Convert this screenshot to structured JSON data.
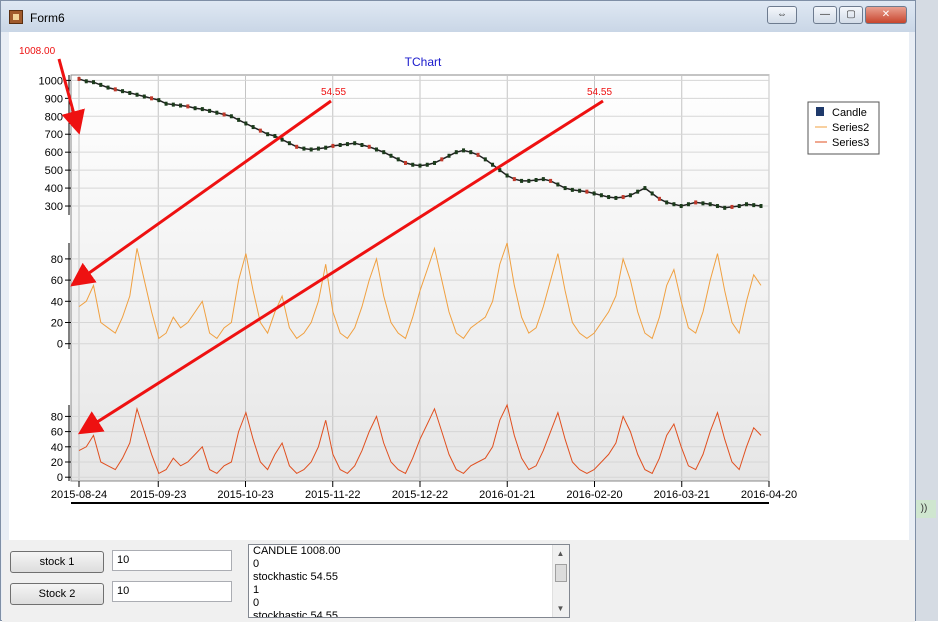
{
  "window": {
    "title": "Form6"
  },
  "titlebar_buttons": [
    "⇔",
    "—",
    "▢",
    "✕"
  ],
  "annotations": {
    "candle_value": "1008.00",
    "stoch_value_1": "54.55",
    "stoch_value_2": "54.55"
  },
  "chart_data": {
    "type": "line",
    "title": "TChart",
    "legend": {
      "placement": "top-right",
      "entries": [
        {
          "name": "Candle",
          "color": "#1f3a6b"
        },
        {
          "name": "Series2",
          "color": "#f0a040"
        },
        {
          "name": "Series3",
          "color": "#e05020"
        }
      ]
    },
    "x_tick_labels": [
      "2015-08-24",
      "2015-09-23",
      "2015-10-23",
      "2015-11-22",
      "2015-12-22",
      "2016-01-21",
      "2016-02-20",
      "2016-03-21",
      "2016-04-20"
    ],
    "panes": [
      {
        "series": "Candle",
        "y_ticks": [
          1000,
          900,
          800,
          700,
          600,
          500,
          400,
          300
        ],
        "ylim": [
          250,
          1030
        ],
        "values": [
          1008,
          995,
          990,
          975,
          960,
          950,
          940,
          930,
          920,
          910,
          900,
          890,
          870,
          865,
          860,
          855,
          845,
          840,
          830,
          820,
          810,
          800,
          780,
          760,
          740,
          720,
          700,
          690,
          670,
          650,
          630,
          620,
          615,
          620,
          625,
          635,
          640,
          645,
          650,
          640,
          630,
          615,
          600,
          580,
          560,
          540,
          530,
          525,
          530,
          540,
          560,
          580,
          600,
          610,
          600,
          585,
          560,
          530,
          500,
          470,
          450,
          440,
          440,
          445,
          450,
          440,
          420,
          400,
          390,
          385,
          380,
          370,
          360,
          350,
          345,
          350,
          360,
          380,
          400,
          370,
          340,
          320,
          310,
          300,
          310,
          320,
          315,
          310,
          300,
          290,
          295,
          300,
          310,
          305,
          300
        ]
      },
      {
        "series": "Series2",
        "y_ticks": [
          80,
          60,
          40,
          20,
          0
        ],
        "ylim": [
          -5,
          95
        ],
        "values": [
          35,
          40,
          55,
          20,
          15,
          10,
          25,
          45,
          90,
          60,
          30,
          5,
          10,
          25,
          15,
          20,
          30,
          40,
          10,
          5,
          15,
          20,
          60,
          85,
          50,
          20,
          10,
          30,
          45,
          15,
          5,
          10,
          20,
          40,
          75,
          30,
          10,
          5,
          15,
          35,
          60,
          80,
          45,
          20,
          10,
          5,
          25,
          50,
          70,
          90,
          60,
          30,
          10,
          5,
          15,
          20,
          25,
          40,
          75,
          95,
          55,
          25,
          10,
          15,
          35,
          60,
          85,
          50,
          20,
          10,
          5,
          10,
          20,
          30,
          45,
          80,
          60,
          30,
          10,
          5,
          25,
          55,
          70,
          40,
          15,
          10,
          30,
          60,
          85,
          50,
          20,
          10,
          40,
          65,
          55
        ]
      },
      {
        "series": "Series3",
        "y_ticks": [
          80,
          60,
          40,
          20,
          0
        ],
        "ylim": [
          -5,
          95
        ],
        "values": [
          35,
          40,
          55,
          20,
          15,
          10,
          25,
          45,
          90,
          60,
          30,
          5,
          10,
          25,
          15,
          20,
          30,
          40,
          10,
          5,
          15,
          20,
          60,
          85,
          50,
          20,
          10,
          30,
          45,
          15,
          5,
          10,
          20,
          40,
          75,
          30,
          10,
          5,
          15,
          35,
          60,
          80,
          45,
          20,
          10,
          5,
          25,
          50,
          70,
          90,
          60,
          30,
          10,
          5,
          15,
          20,
          25,
          40,
          75,
          95,
          55,
          25,
          10,
          15,
          35,
          60,
          85,
          50,
          20,
          10,
          5,
          10,
          20,
          30,
          45,
          80,
          60,
          30,
          10,
          5,
          25,
          55,
          70,
          40,
          15,
          10,
          30,
          60,
          85,
          50,
          20,
          10,
          40,
          65,
          55
        ]
      }
    ]
  },
  "controls": {
    "stock1_label": "stock 1",
    "stock1_value": "10",
    "stock2_label": "Stock 2",
    "stock2_value": "10"
  },
  "memo": {
    "lines": [
      "CANDLE 1008.00",
      "0",
      "stockhastic 54.55",
      "1",
      "0",
      "stockhastic 54.55"
    ]
  },
  "right_fragment": "))"
}
